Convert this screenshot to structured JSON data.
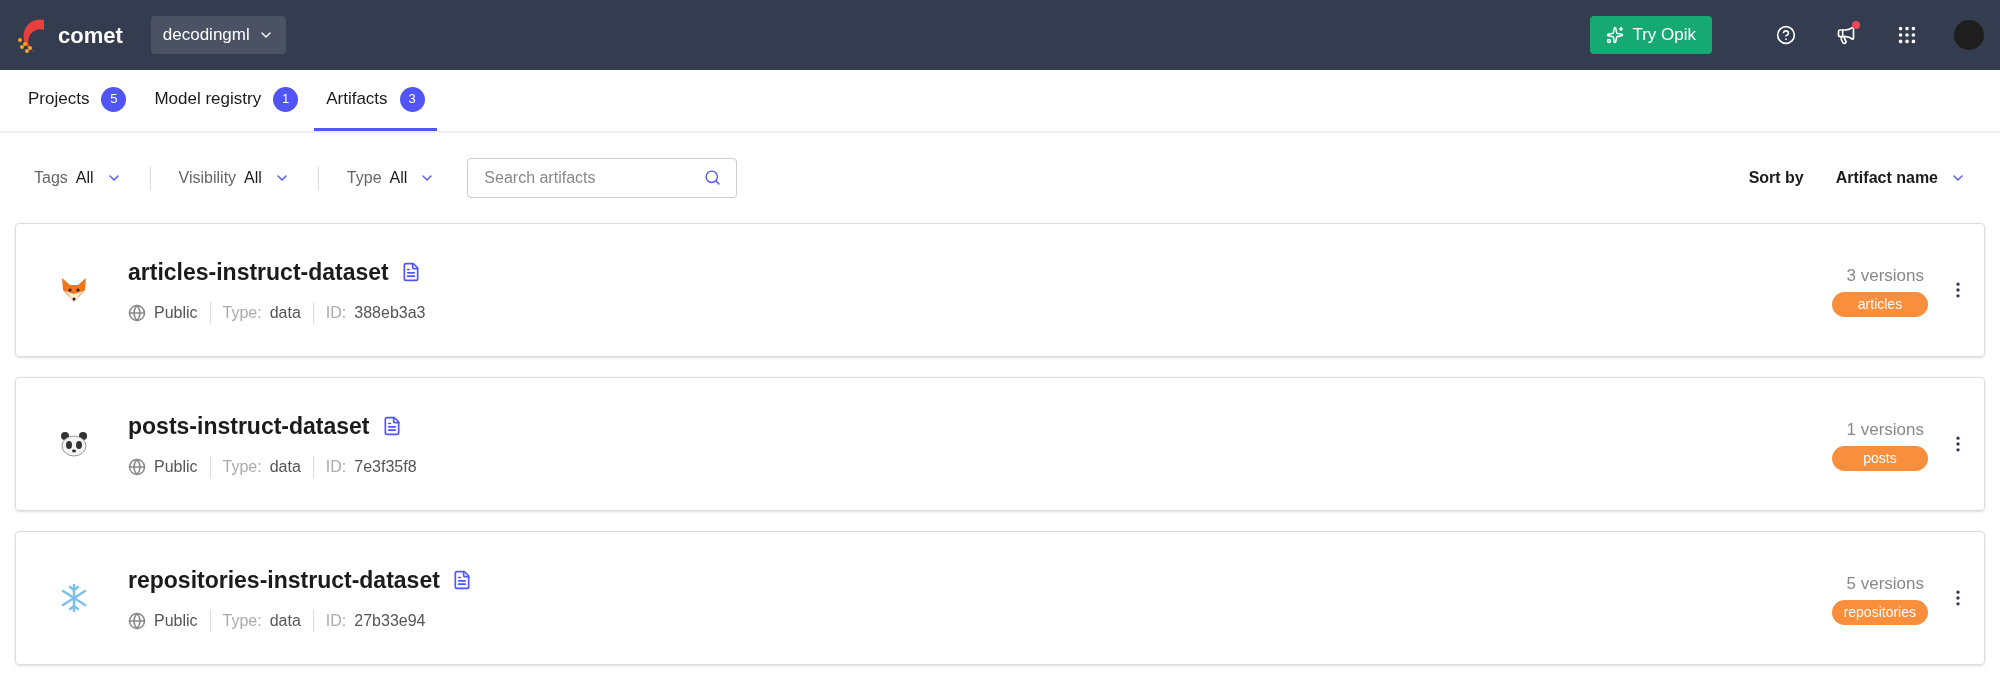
{
  "header": {
    "logo": "comet",
    "workspace": "decodingml",
    "try_button": "Try Opik",
    "notification_dot": true
  },
  "tabs": [
    {
      "label": "Projects",
      "count": "5",
      "selected": false
    },
    {
      "label": "Model registry",
      "count": "1",
      "selected": false
    },
    {
      "label": "Artifacts",
      "count": "3",
      "selected": true
    }
  ],
  "filters": [
    {
      "label": "Tags",
      "value": "All"
    },
    {
      "label": "Visibility",
      "value": "All"
    },
    {
      "label": "Type",
      "value": "All"
    }
  ],
  "search": {
    "placeholder": "Search artifacts"
  },
  "sort": {
    "label": "Sort by",
    "value": "Artifact name"
  },
  "artifacts": [
    {
      "name": "articles-instruct-dataset",
      "visibility": "Public",
      "type_label": "Type:",
      "type": "data",
      "id_label": "ID:",
      "id": "388eb3a3",
      "versions": "3 versions",
      "tag": "articles"
    },
    {
      "name": "posts-instruct-dataset",
      "visibility": "Public",
      "type_label": "Type:",
      "type": "data",
      "id_label": "ID:",
      "id": "7e3f35f8",
      "versions": "1 versions",
      "tag": "posts"
    },
    {
      "name": "repositories-instruct-dataset",
      "visibility": "Public",
      "type_label": "Type:",
      "type": "data",
      "id_label": "ID:",
      "id": "27b33e94",
      "versions": "5 versions",
      "tag": "repositories"
    }
  ]
}
